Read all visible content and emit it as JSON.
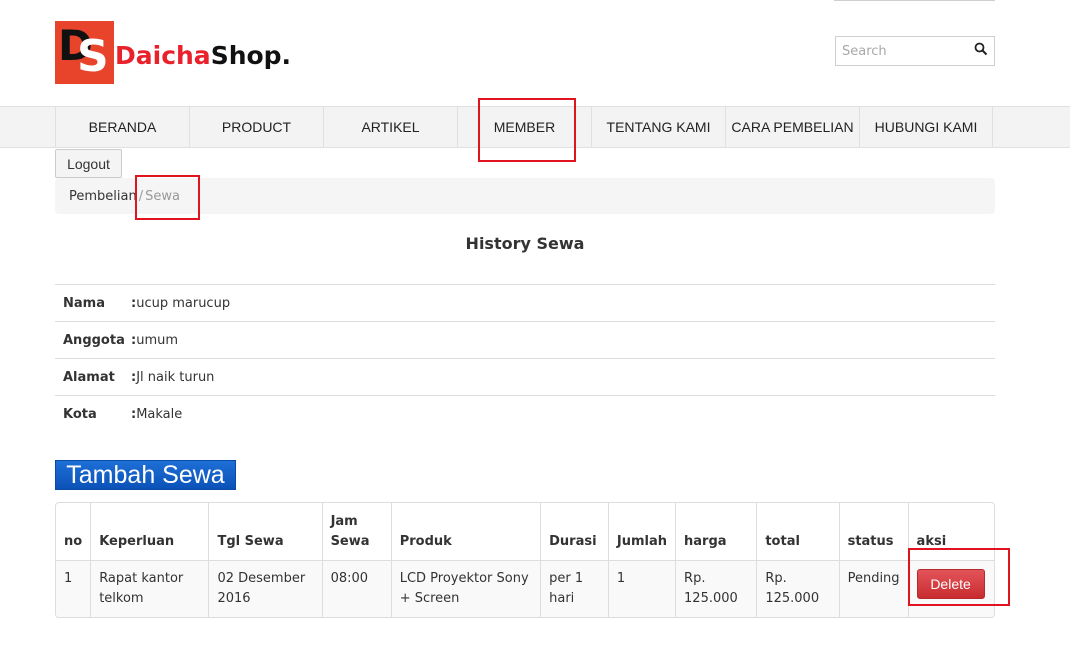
{
  "brand": {
    "mark": "DS",
    "name_red": "Daicha",
    "name_dark": "Shop."
  },
  "search": {
    "placeholder": "Search"
  },
  "nav": {
    "items": [
      {
        "label": "BERANDA"
      },
      {
        "label": "PRODUCT"
      },
      {
        "label": "ARTIKEL"
      },
      {
        "label": "MEMBER"
      },
      {
        "label": "TENTANG KAMI"
      },
      {
        "label": "CARA PEMBELIAN"
      },
      {
        "label": "HUBUNGI KAMI"
      }
    ]
  },
  "logout_label": "Logout",
  "breadcrumb": {
    "parent": "Pembelian",
    "separator": "/",
    "current": "Sewa"
  },
  "page_title": "History Sewa",
  "member_info": [
    {
      "label": "Nama",
      "value": "ucup marucup"
    },
    {
      "label": "Anggota",
      "value": "umum"
    },
    {
      "label": "Alamat",
      "value": "Jl naik turun"
    },
    {
      "label": "Kota",
      "value": "Makale"
    }
  ],
  "tambah_label": "Tambah Sewa",
  "table": {
    "headers": [
      "no",
      "Keperluan",
      "Tgl Sewa",
      "Jam Sewa",
      "Produk",
      "Durasi",
      "Jumlah",
      "harga",
      "total",
      "status",
      "aksi"
    ],
    "rows": [
      {
        "no": "1",
        "keperluan": "Rapat kantor telkom",
        "tgl_sewa": "02 Desember 2016",
        "jam_sewa": "08:00",
        "produk": "LCD Proyektor Sony + Screen",
        "durasi": "per 1 hari",
        "jumlah": "1",
        "harga": "Rp. 125.000",
        "total": "Rp. 125.000",
        "status": "Pending",
        "aksi_label": "Delete"
      }
    ]
  },
  "colors": {
    "brand_red": "#e8432b",
    "tambah_blue": "#0b52b8",
    "delete_red": "#c82c2f",
    "highlight_red": "#e0141e"
  },
  "icons": {
    "search": "search-icon"
  }
}
